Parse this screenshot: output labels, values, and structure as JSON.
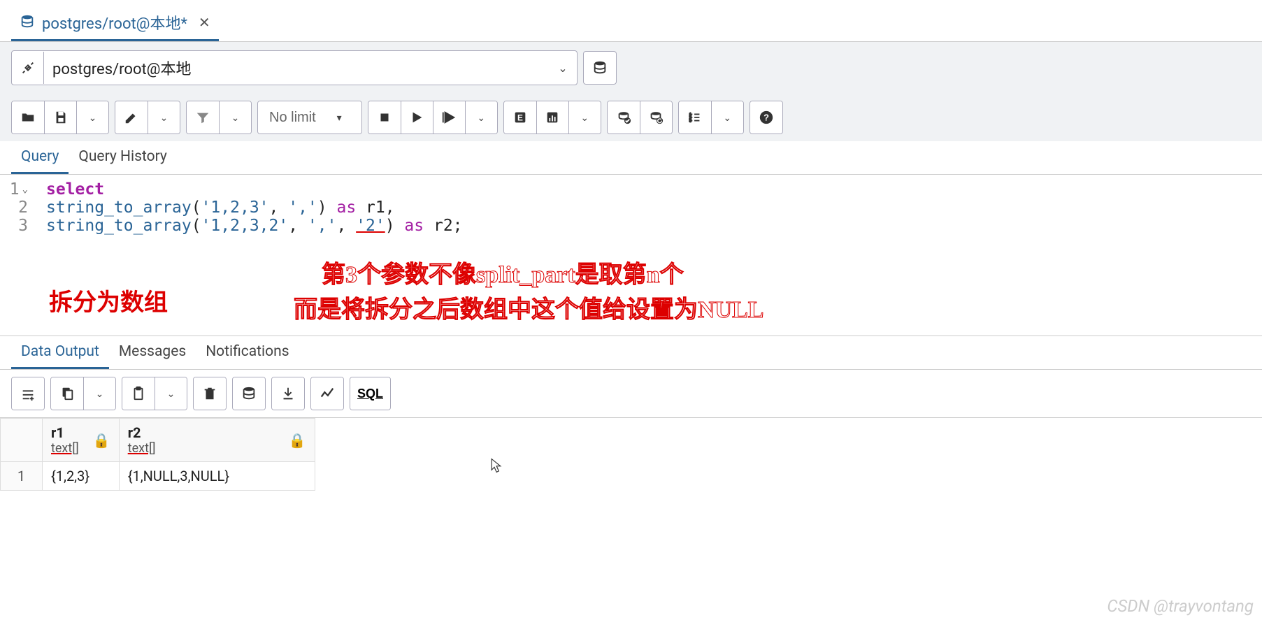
{
  "tab": {
    "title": "postgres/root@本地*"
  },
  "connection": {
    "value": "postgres/root@本地"
  },
  "toolbar": {
    "limit": "No limit"
  },
  "editor_tabs": {
    "query": "Query",
    "history": "Query History"
  },
  "code": {
    "lines": [
      {
        "n": "1",
        "fold": true
      },
      {
        "n": "2"
      },
      {
        "n": "3"
      }
    ],
    "tokens": {
      "select": "select",
      "fn": "string_to_array",
      "str123": "'1,2,3'",
      "comma_str": "','",
      "as": "as",
      "r1": "r1",
      "str1232": "'1,2,3,2'",
      "str2": "'2'",
      "r2": "r2"
    }
  },
  "annotations": {
    "left": "拆分为数组",
    "right1": "第3个参数不像split_part是取第n个",
    "right2": "而是将拆分之后数组中这个值给设置为NULL"
  },
  "result_tabs": {
    "data": "Data Output",
    "messages": "Messages",
    "notifications": "Notifications"
  },
  "result_toolbar": {
    "sql": "SQL"
  },
  "grid": {
    "columns": [
      {
        "name": "r1",
        "type": "text[]"
      },
      {
        "name": "r2",
        "type": "text[]"
      }
    ],
    "rows": [
      {
        "num": "1",
        "r1": "{1,2,3}",
        "r2": "{1,NULL,3,NULL}"
      }
    ]
  },
  "watermark": "CSDN @trayvontang"
}
